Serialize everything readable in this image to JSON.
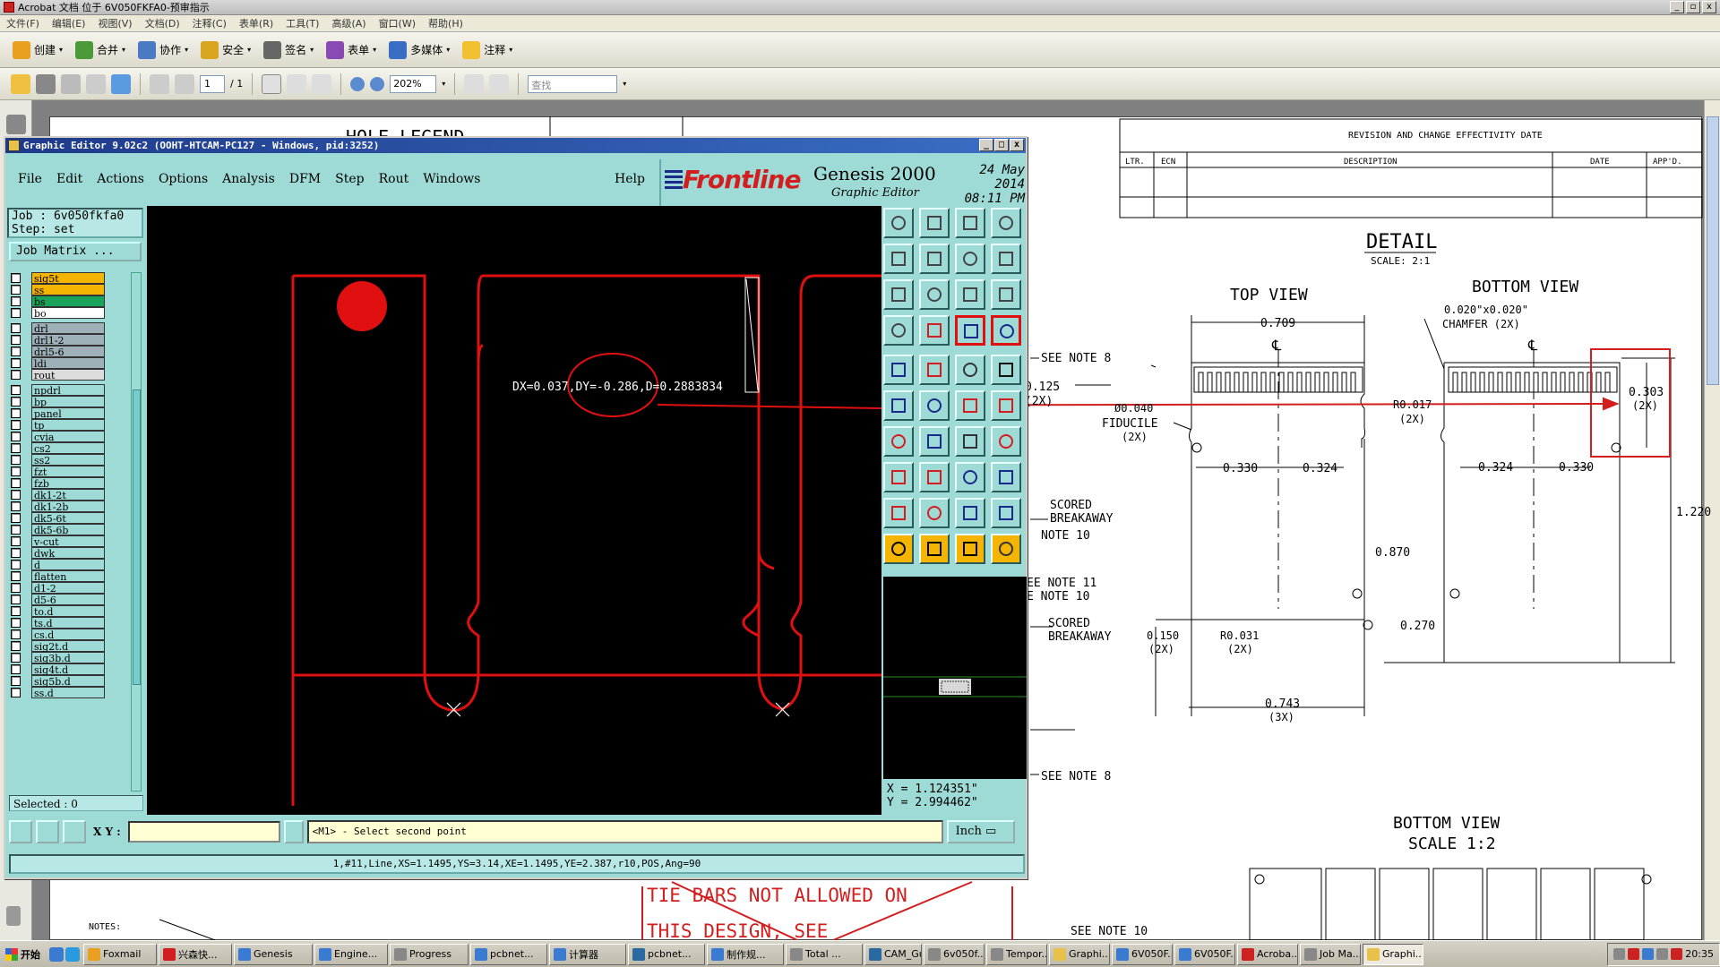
{
  "acrobat": {
    "title": "Acrobat 文档 位于 6V050FKFA0-预审指示",
    "menu": [
      "文件(F)",
      "编辑(E)",
      "视图(V)",
      "文档(D)",
      "注释(C)",
      "表单(R)",
      "工具(T)",
      "高级(A)",
      "窗口(W)",
      "帮助(H)"
    ],
    "toolbar1": [
      "创建",
      "合并",
      "协作",
      "安全",
      "签名",
      "表单",
      "多媒体",
      "注释"
    ],
    "page_current": "1",
    "page_total": "/ 1",
    "zoom": "202%",
    "find_placeholder": "查找"
  },
  "drawing": {
    "hole_legend": "HOLE LEGEND",
    "revision_header": "REVISION AND CHANGE EFFECTIVITY DATE",
    "rev_cols": [
      "LTR.",
      "ECN",
      "DESCRIPTION",
      "DATE",
      "APP'D."
    ],
    "detail": "DETAIL",
    "detail_scale": "SCALE: 2:1",
    "top_view": "TOP VIEW",
    "bottom_view": "BOTTOM VIEW",
    "bottom_view2": "BOTTOM VIEW",
    "bottom_scale": "SCALE 1:2",
    "dim_0709": "0.709",
    "chamfer1": "0.020\"x0.020\"",
    "chamfer2": "CHAMFER (2X)",
    "cl1": "℄",
    "cl2": "℄",
    "see_note_8a": "SEE NOTE 8",
    "dim_0125": "0.125",
    "dim_0125b": "(2X)",
    "fid1": "Ø0.040",
    "fid2": "FIDUCILE",
    "fid3": "(2X)",
    "r0017": "R0.017",
    "r0017b": "(2X)",
    "dim_0303": "0.303",
    "dim_0303b": "(2X)",
    "dim_0330a": "0.330",
    "dim_0324a": "0.324",
    "dim_0324b": "0.324",
    "dim_0330b": "0.330",
    "dim_1220": "1.220",
    "scored1": "SCORED",
    "breakaway1": "BREAKAWAY",
    "note10a": "NOTE 10",
    "dim_0870": "0.870",
    "note11": "EE NOTE 11",
    "note10b": "E NOTE 10",
    "scored2": "SCORED",
    "breakaway2": "BREAKAWAY",
    "dim_0150": "0.150",
    "dim_0150b": "(2X)",
    "r0031": "R0.031",
    "r0031b": "(2X)",
    "dim_0270": "0.270",
    "dim_0743": "0.743",
    "dim_0743b": "(3X)",
    "see_note_8b": "SEE NOTE 8",
    "see_note_10": "SEE NOTE 10",
    "notes": "NOTES:",
    "tie1": "TIE BARS NOT ALLOWED ON",
    "tie2": "THIS DESIGN, SEE"
  },
  "genesis": {
    "title": "Graphic Editor 9.02c2 (OOHT-HTCAM-PC127 - Windows, pid:3252)",
    "menu": [
      "File",
      "Edit",
      "Actions",
      "Options",
      "Analysis",
      "DFM",
      "Step",
      "Rout",
      "Windows"
    ],
    "help": "Help",
    "logo": "Frontline",
    "product": "Genesis 2000",
    "subtitle": "Graphic Editor",
    "date": "24 May 2014",
    "time": "08:11 PM",
    "job": "Job : 6v050fkfa0",
    "step": "Step: set",
    "job_matrix": "Job Matrix ...",
    "measure": "DX=0.037,DY=-0.286,D=0.2883834",
    "coord_x": "X = 1.124351\"",
    "coord_y": "Y = 2.994462\"",
    "xy_label": "X Y :",
    "xy_value": "",
    "message": "<M1> - Select second point",
    "unit": "Inch",
    "selected": "Selected : 0",
    "status": "1,#11,Line,XS=1.1495,YS=3.14,XE=1.1495,YE=2.387,r10,POS,Ang=90",
    "layers": [
      {
        "name": "sig5t",
        "color": "#f5b400"
      },
      {
        "name": "ss",
        "color": "#f5b400"
      },
      {
        "name": "bs",
        "color": "#1aa35a"
      },
      {
        "name": "bo",
        "color": "#ffffff"
      },
      {
        "name": "drl",
        "color": "#9eb0b8"
      },
      {
        "name": "drl1-2",
        "color": "#9eb0b8"
      },
      {
        "name": "drl5-6",
        "color": "#9eb0b8"
      },
      {
        "name": "ldi",
        "color": "#9eb0b8"
      },
      {
        "name": "rout",
        "color": "#dcdcdc"
      },
      {
        "name": "npdrl",
        "color": "#9edbd7"
      },
      {
        "name": "bp",
        "color": "#9edbd7"
      },
      {
        "name": "panel",
        "color": "#9edbd7"
      },
      {
        "name": "tp",
        "color": "#9edbd7"
      },
      {
        "name": "cvia",
        "color": "#9edbd7"
      },
      {
        "name": "cs2",
        "color": "#9edbd7"
      },
      {
        "name": "ss2",
        "color": "#9edbd7"
      },
      {
        "name": "fzt",
        "color": "#9edbd7"
      },
      {
        "name": "fzb",
        "color": "#9edbd7"
      },
      {
        "name": "dk1-2t",
        "color": "#9edbd7"
      },
      {
        "name": "dk1-2b",
        "color": "#9edbd7"
      },
      {
        "name": "dk5-6t",
        "color": "#9edbd7"
      },
      {
        "name": "dk5-6b",
        "color": "#9edbd7"
      },
      {
        "name": "v-cut",
        "color": "#9edbd7"
      },
      {
        "name": "dwk",
        "color": "#9edbd7"
      },
      {
        "name": "d",
        "color": "#9edbd7"
      },
      {
        "name": "flatten",
        "color": "#9edbd7"
      },
      {
        "name": "d1-2",
        "color": "#9edbd7"
      },
      {
        "name": "d5-6",
        "color": "#9edbd7"
      },
      {
        "name": "to.d",
        "color": "#9edbd7"
      },
      {
        "name": "ts.d",
        "color": "#9edbd7"
      },
      {
        "name": "cs.d",
        "color": "#9edbd7"
      },
      {
        "name": "sig2t.d",
        "color": "#9edbd7"
      },
      {
        "name": "sig3b.d",
        "color": "#9edbd7"
      },
      {
        "name": "sig4t.d",
        "color": "#9edbd7"
      },
      {
        "name": "sig5b.d",
        "color": "#9edbd7"
      },
      {
        "name": "ss.d",
        "color": "#9edbd7"
      }
    ],
    "tool_icons": [
      "zoom-window-icon",
      "zoom-fit-icon",
      "home-view-icon",
      "pan-icon",
      "shift-left-icon",
      "shift-right-icon",
      "redraw-icon",
      "snap-icon",
      "fit-screen-icon",
      "center-icon",
      "ratio-icon",
      "help-icon",
      "measure-icon",
      "probe-icon",
      "layer-a-icon",
      "layer-b-icon",
      "pad-add-icon",
      "surface-add-icon",
      "line-style-icon",
      "dot-icon",
      "net-icon",
      "cross-icon",
      "route-icon",
      "connect-icon",
      "angle-icon",
      "slash-icon",
      "arc-icon",
      "split-icon",
      "move-icon",
      "minus-icon",
      "box-icon",
      "grid-icon",
      "tri-a-icon",
      "tri-b-icon",
      "tri-c-icon",
      "tri-d-icon",
      "pointer-icon",
      "select-icon",
      "pointer-alt-icon",
      "edit-icon"
    ]
  },
  "taskbar": {
    "start": "开始",
    "items": [
      "Foxmail",
      "兴森快...",
      "Genesis",
      "Engine...",
      "Progress",
      "pcbnet...",
      "计算器",
      "pcbnet...",
      "制作规...",
      "Total ...",
      "CAM_Gu...",
      "6v050f...",
      "Tempor...",
      "Graphi...",
      "6V050F...",
      "6V050F...",
      "Acroba...",
      "Job Ma...",
      "Graphi..."
    ],
    "clock": "20:35"
  }
}
